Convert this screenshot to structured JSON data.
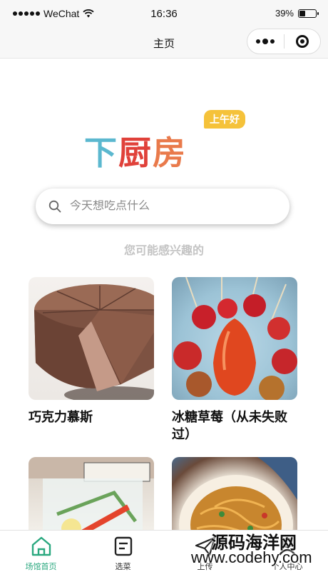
{
  "status_bar": {
    "carrier": "WeChat",
    "time": "16:36",
    "battery_text": "39%",
    "battery_level": 0.39
  },
  "nav": {
    "title": "主页"
  },
  "logo": {
    "text_part1": "下",
    "text_part2": "厨",
    "text_part3": "房",
    "badge": "上午好"
  },
  "search": {
    "placeholder": "今天想吃点什么"
  },
  "recommend": {
    "title": "您可能感兴趣的",
    "items": [
      {
        "name": "巧克力慕斯",
        "image": "chocolate-mousse-cake"
      },
      {
        "name": "冰糖草莓（从未失败过）",
        "image": "candied-strawberries"
      },
      {
        "name": "",
        "image": "fruit-drink"
      },
      {
        "name": "",
        "image": "fried-noodles"
      }
    ]
  },
  "tab_bar": {
    "items": [
      {
        "label": "场馆首页",
        "icon": "home-icon",
        "active": true
      },
      {
        "label": "选菜",
        "icon": "menu-list-icon",
        "active": false
      },
      {
        "label": "上传",
        "icon": "send-icon",
        "active": false
      },
      {
        "label": "个人中心",
        "icon": "user-icon",
        "active": false
      }
    ]
  },
  "watermark": {
    "line1": "源码海洋网",
    "line2": "www.codehy.com"
  },
  "colors": {
    "accent": "#2aa87f",
    "logo_blue": "#5bb8cf",
    "logo_red": "#e0413a",
    "logo_orange": "#e97a4b",
    "badge_yellow": "#f5c23a"
  }
}
